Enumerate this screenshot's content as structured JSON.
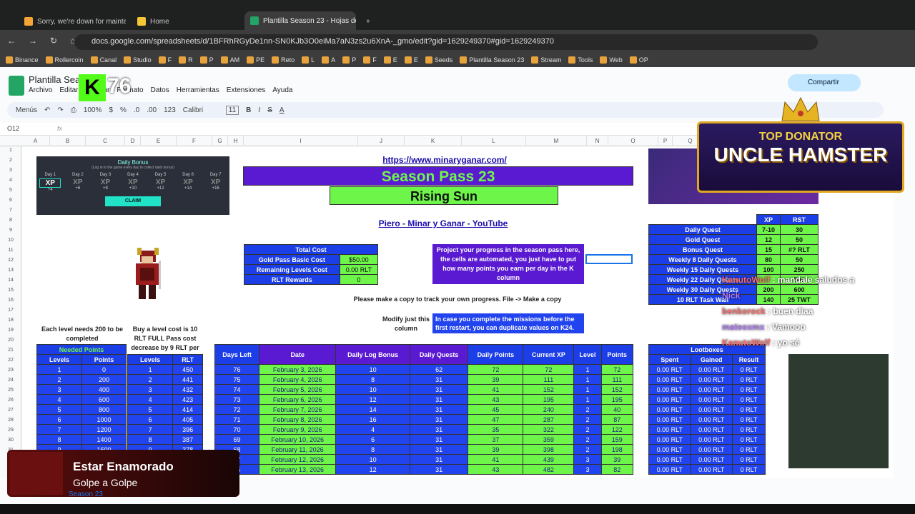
{
  "tabs": [
    {
      "label": "Sorry, we're down for maintenan"
    },
    {
      "label": "Home"
    },
    {
      "label": "Plantilla Season 23 - Hojas de cál"
    }
  ],
  "url": "docs.google.com/spreadsheets/d/1BFRhRGyDe1nn-SN0KJb3O0eiMa7aN3zs2u6XnA-_gmo/edit?gid=1629249370#gid=1629249370",
  "bookmarks": [
    "Binance",
    "Rollercoin",
    "Canal",
    "Studio",
    "F",
    "R",
    "P",
    "AM",
    "PE",
    "Reto",
    "L",
    "A",
    "P",
    "F",
    "E",
    "E",
    "Seeds",
    "Plantilla Season 23",
    "Stream",
    "Tools",
    "Web",
    "OP"
  ],
  "doc": {
    "title": "Plantilla Seas",
    "menus": [
      "Archivo",
      "Editar",
      "Insertar",
      "Formato",
      "Datos",
      "Herramientas",
      "Extensiones",
      "Ayuda"
    ],
    "share": "Compartir"
  },
  "toolbar": {
    "menus": "Menús",
    "zoom": "100%",
    "font": "Calibri",
    "size": "11",
    "currency": "$",
    "percent": "%",
    "dec_less": ".0",
    "dec_more": ".00",
    "format": "123"
  },
  "formula": {
    "cell": "O12",
    "fx": "fx"
  },
  "columns": [
    "A",
    "B",
    "C",
    "D",
    "E",
    "F",
    "G",
    "H",
    "I",
    "J",
    "K",
    "L",
    "M",
    "N",
    "O",
    "P",
    "Q"
  ],
  "rows": [
    "1",
    "2",
    "3",
    "4",
    "5",
    "6",
    "7",
    "8",
    "9",
    "10",
    "11",
    "12",
    "13",
    "14",
    "15",
    "16",
    "17",
    "18",
    "19",
    "20",
    "21",
    "22",
    "23",
    "24",
    "25",
    "26",
    "27",
    "28",
    "29",
    "30",
    "31"
  ],
  "daily_bonus": {
    "title": "Daily Bonus",
    "subtitle": "(Log in to the game every day to collect daily bonus)",
    "days": [
      "Day 1",
      "Day 2",
      "Day 3",
      "Day 4",
      "Day 5",
      "Day 6",
      "Day 7"
    ],
    "rewards": [
      "+4",
      "+6",
      "+8",
      "+10",
      "+12",
      "+14",
      "+16"
    ],
    "claim": "CLAIM"
  },
  "link": "https://www.minaryganar.com/",
  "season": "Season Pass 23",
  "subtitle": "Rising Sun",
  "youtube": "Piero - Minar y Ganar - YouTube",
  "cost": {
    "header": "Total Cost",
    "rows": [
      [
        "Gold Pass Basic Cost",
        "$50.00"
      ],
      [
        "Remaining Levels Cost",
        "0.00 RLT"
      ],
      [
        "RLT Rewards",
        "0"
      ]
    ]
  },
  "project_note": "Project your progress in the season pass here, the cells are automated, you just have to put how many points you earn per day in the K column",
  "copy_note": "Please make a copy to track your own progress. File -> Make a copy",
  "restart_note": "In case you complete the missions before the first restart, you can duplicate values on K24.",
  "modify_note": "Modify just this column",
  "level_note": "Each level needs 200 to be completed",
  "buy_note": "Buy a level cost is 10 RLT FULL Pass cost decrease by 9 RLT per lvl",
  "quests": {
    "headers": [
      "XP",
      "RST"
    ],
    "rows": [
      [
        "Daily Quest",
        "7-10",
        "30"
      ],
      [
        "Gold Quest",
        "12",
        "50"
      ],
      [
        "Bonus Quest",
        "15",
        "#? RLT"
      ],
      [
        "Weekly 8 Daily Quests",
        "80",
        "50"
      ],
      [
        "Weekly 15 Daily Quests",
        "100",
        "250"
      ],
      [
        "Weekly 22 Daily Quests",
        "",
        "500"
      ],
      [
        "Weekly 30 Daily Quests",
        "200",
        "600"
      ],
      [
        "10 RLT Task Wall",
        "140",
        "25 TWT"
      ]
    ]
  },
  "needed": {
    "title": "Needed Points",
    "headers": [
      "Levels",
      "Points"
    ],
    "rows": [
      [
        "1",
        "0"
      ],
      [
        "2",
        "200"
      ],
      [
        "3",
        "400"
      ],
      [
        "4",
        "600"
      ],
      [
        "5",
        "800"
      ],
      [
        "6",
        "1000"
      ],
      [
        "7",
        "1200"
      ],
      [
        "8",
        "1400"
      ],
      [
        "9",
        "1600"
      ]
    ]
  },
  "buy": {
    "headers": [
      "Levels",
      "RLT"
    ],
    "rows": [
      [
        "1",
        "450"
      ],
      [
        "2",
        "441"
      ],
      [
        "3",
        "432"
      ],
      [
        "4",
        "423"
      ],
      [
        "5",
        "414"
      ],
      [
        "6",
        "405"
      ],
      [
        "7",
        "396"
      ],
      [
        "8",
        "387"
      ],
      [
        "9",
        "378"
      ]
    ]
  },
  "main": {
    "headers": [
      "Days Left",
      "Date",
      "Daily Log Bonus",
      "Daily Quests",
      "Daily Points",
      "Current XP",
      "Level",
      "Points"
    ],
    "rows": [
      [
        "76",
        "February 3, 2026",
        "10",
        "62",
        "72",
        "72",
        "1",
        "72"
      ],
      [
        "75",
        "February 4, 2026",
        "8",
        "31",
        "39",
        "111",
        "1",
        "111"
      ],
      [
        "74",
        "February 5, 2026",
        "10",
        "31",
        "41",
        "152",
        "1",
        "152"
      ],
      [
        "73",
        "February 6, 2026",
        "12",
        "31",
        "43",
        "195",
        "1",
        "195"
      ],
      [
        "72",
        "February 7, 2026",
        "14",
        "31",
        "45",
        "240",
        "2",
        "40"
      ],
      [
        "71",
        "February 8, 2026",
        "16",
        "31",
        "47",
        "287",
        "2",
        "87"
      ],
      [
        "70",
        "February 9, 2026",
        "4",
        "31",
        "35",
        "322",
        "2",
        "122"
      ],
      [
        "69",
        "February 10, 2026",
        "6",
        "31",
        "37",
        "359",
        "2",
        "159"
      ],
      [
        "68",
        "February 11, 2026",
        "8",
        "31",
        "39",
        "398",
        "2",
        "198"
      ],
      [
        "67",
        "February 12, 2026",
        "10",
        "31",
        "41",
        "439",
        "3",
        "39"
      ],
      [
        "66",
        "February 13, 2026",
        "12",
        "31",
        "43",
        "482",
        "3",
        "82"
      ]
    ]
  },
  "loot": {
    "title": "Lootboxes",
    "headers": [
      "Spent",
      "Gained",
      "Result"
    ],
    "rows": [
      [
        "0.00 RLT",
        "0.00 RLT",
        "0 RLT"
      ],
      [
        "0.00 RLT",
        "0.00 RLT",
        "0 RLT"
      ],
      [
        "0.00 RLT",
        "0.00 RLT",
        "0 RLT"
      ],
      [
        "0.00 RLT",
        "0.00 RLT",
        "0 RLT"
      ],
      [
        "0.00 RLT",
        "0.00 RLT",
        "0 RLT"
      ],
      [
        "0.00 RLT",
        "0.00 RLT",
        "0 RLT"
      ],
      [
        "0.00 RLT",
        "0.00 RLT",
        "0 RLT"
      ],
      [
        "0.00 RLT",
        "0.00 RLT",
        "0 RLT"
      ],
      [
        "0.00 RLT",
        "0.00 RLT",
        "0 RLT"
      ],
      [
        "0.00 RLT",
        "0.00 RLT",
        "0 RLT"
      ],
      [
        "0.00 RLT",
        "0.00 RLT",
        "0 RLT"
      ]
    ]
  },
  "overlay": {
    "k": "K",
    "num": "76",
    "donator_top": "TOP DONATOR",
    "donator_name": "UNCLE HAMSTER",
    "song": "Estar Enamorado",
    "artist": "Golpe a Golpe"
  },
  "chat": [
    {
      "user": "KanutoWolf",
      "msg": "mandale saludos a"
    },
    {
      "user": "Nick",
      "msg": ""
    },
    {
      "user": "benkorock",
      "msg": "buen diaa"
    },
    {
      "user": "mateoxmx",
      "msg": "Vamooo"
    },
    {
      "user": "KanutoWolf",
      "msg": "yo sé"
    }
  ],
  "sheet_tab": "Season 23"
}
